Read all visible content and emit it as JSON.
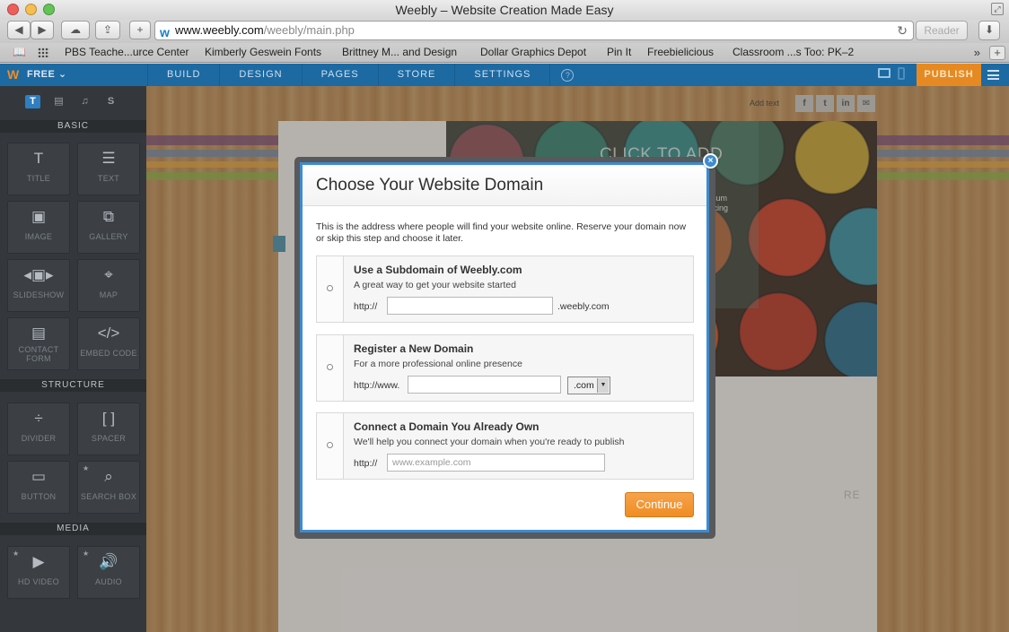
{
  "browser": {
    "title": "Weebly – Website Creation Made Easy",
    "url_domain": "www.weebly.com",
    "url_path": "/weebly/main.php",
    "reader_label": "Reader",
    "bookmarks": [
      "PBS Teache...urce Center",
      "Kimberly Geswein Fonts",
      "Brittney M... and Design",
      "Dollar Graphics Depot",
      "Pin It",
      "Freebielicious",
      "Classroom ...s Too: PK–2"
    ],
    "more_label": "»",
    "new_tab_label": "+"
  },
  "weebly_nav": {
    "logo": "W",
    "plan_label": "FREE ⌄",
    "tabs": [
      "BUILD",
      "DESIGN",
      "PAGES",
      "STORE",
      "SETTINGS"
    ],
    "help_label": "?",
    "publish_label": "PUBLISH"
  },
  "sidebar": {
    "tab_icons": [
      "T",
      "▤",
      "♫",
      "S"
    ],
    "sections": {
      "basic": "BASIC",
      "structure": "STRUCTURE",
      "media": "MEDIA"
    },
    "tiles": {
      "title": {
        "icon": "T",
        "label": "TITLE"
      },
      "text": {
        "icon": "☰",
        "label": "TEXT"
      },
      "image": {
        "icon": "▣",
        "label": "IMAGE"
      },
      "gallery": {
        "icon": "⧉",
        "label": "GALLERY"
      },
      "slideshow": {
        "icon": "◂▣▸",
        "label": "SLIDESHOW"
      },
      "map": {
        "icon": "⌖",
        "label": "MAP"
      },
      "contact_form": {
        "icon": "▤",
        "label": "CONTACT FORM"
      },
      "embed_code": {
        "icon": "</>",
        "label": "EMBED CODE"
      },
      "divider": {
        "icon": "÷",
        "label": "DIVIDER"
      },
      "spacer": {
        "icon": "[ ]",
        "label": "SPACER"
      },
      "button": {
        "icon": "▭",
        "label": "BUTTON"
      },
      "search_box": {
        "icon": "⌕",
        "label": "SEARCH BOX"
      },
      "hd_video": {
        "icon": "▶",
        "label": "HD VIDEO"
      },
      "audio": {
        "icon": "🔊",
        "label": "AUDIO"
      }
    },
    "premium_star": "★"
  },
  "canvas": {
    "add_text": "Add text",
    "social_icons": [
      "f",
      "t",
      "in",
      "✉"
    ],
    "click_to_add": "CLICK TO ADD",
    "hero_text_line1": "psum",
    "hero_text_line2": "iscing",
    "ghost_text": "RE"
  },
  "modal": {
    "title": "Choose Your Website Domain",
    "close_label": "×",
    "intro": "This is the address where people will find your website online. Reserve your domain now or skip this step and choose it later.",
    "options": [
      {
        "title": "Use a Subdomain of Weebly.com",
        "subtitle": "A great way to get your website started",
        "prefix": "http://",
        "value": "",
        "placeholder": "",
        "suffix": ".weebly.com"
      },
      {
        "title": "Register a New Domain",
        "subtitle": "For a more professional online presence",
        "prefix": "http://www.",
        "value": "",
        "placeholder": "",
        "tld_selected": ".com"
      },
      {
        "title": "Connect a Domain You Already Own",
        "subtitle": "We'll help you connect your domain when you're ready to publish",
        "prefix": "http://",
        "value": "",
        "placeholder": "www.example.com"
      }
    ],
    "continue_label": "Continue"
  }
}
